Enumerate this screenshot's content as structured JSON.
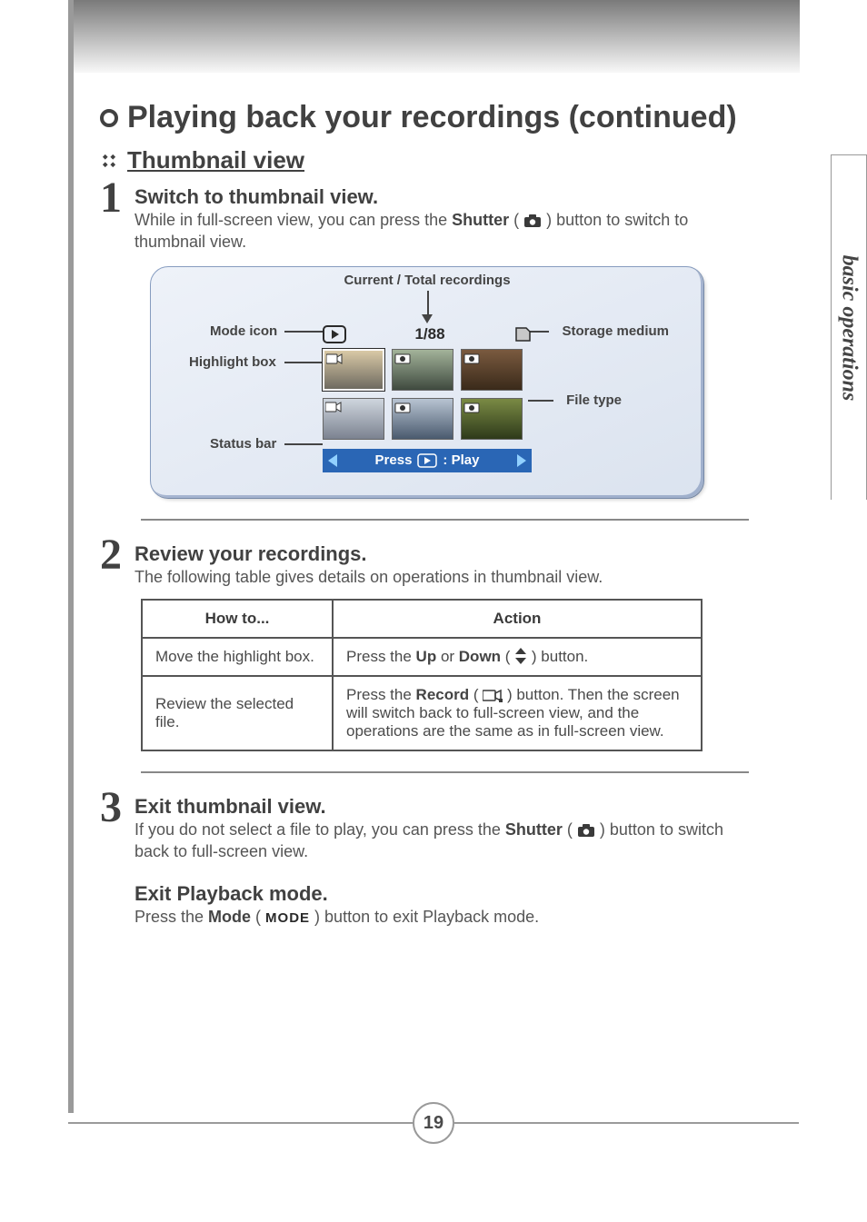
{
  "side_tab": "basic operations",
  "h1": "Playing back your recordings (continued)",
  "h2": "Thumbnail view",
  "steps": {
    "s1": {
      "num": "1",
      "title": "Switch to thumbnail view.",
      "text_a": "While in full-screen view, you can press the ",
      "text_b": "Shutter",
      "text_c": " ( ",
      "text_d": " ) button to switch to thumbnail view."
    },
    "s2": {
      "num": "2",
      "title": "Review your recordings.",
      "text": "The following table gives details on operations in thumbnail view."
    },
    "s3": {
      "num": "3",
      "title": "Exit thumbnail view.",
      "text_a": "If you do not select a file to play, you can press the ",
      "text_b": "Shutter",
      "text_c": " ( ",
      "text_d": " ) button to switch back to full-screen view."
    },
    "s4": {
      "title": "Exit Playback mode.",
      "text_a": "Press the ",
      "text_b": "Mode",
      "text_c": " ( ",
      "mode_word": "MODE",
      "text_d": " ) button to exit Playback mode."
    }
  },
  "diagram": {
    "label_top": "Current / Total recordings",
    "label_mode": "Mode icon",
    "label_highlight": "Highlight box",
    "label_status": "Status bar",
    "label_storage": "Storage medium",
    "label_filetype": "File type",
    "counter": "1/88",
    "status_text_a": "Press",
    "status_text_b": ": Play"
  },
  "table": {
    "head": {
      "c1": "How to...",
      "c2": "Action"
    },
    "rows": [
      {
        "c1": "Move the highlight box.",
        "c2_a": "Press the ",
        "c2_b": "Up",
        "c2_c": " or ",
        "c2_d": "Down",
        "c2_e": " ( ",
        "c2_f": " ) button."
      },
      {
        "c1": "Review the selected file.",
        "c2_a": "Press the ",
        "c2_b": "Record",
        "c2_c": " ( ",
        "c2_d": " ) button. Then the screen will switch back to full-screen view, and the operations are the same as in full-screen view."
      }
    ]
  },
  "page_number": "19"
}
